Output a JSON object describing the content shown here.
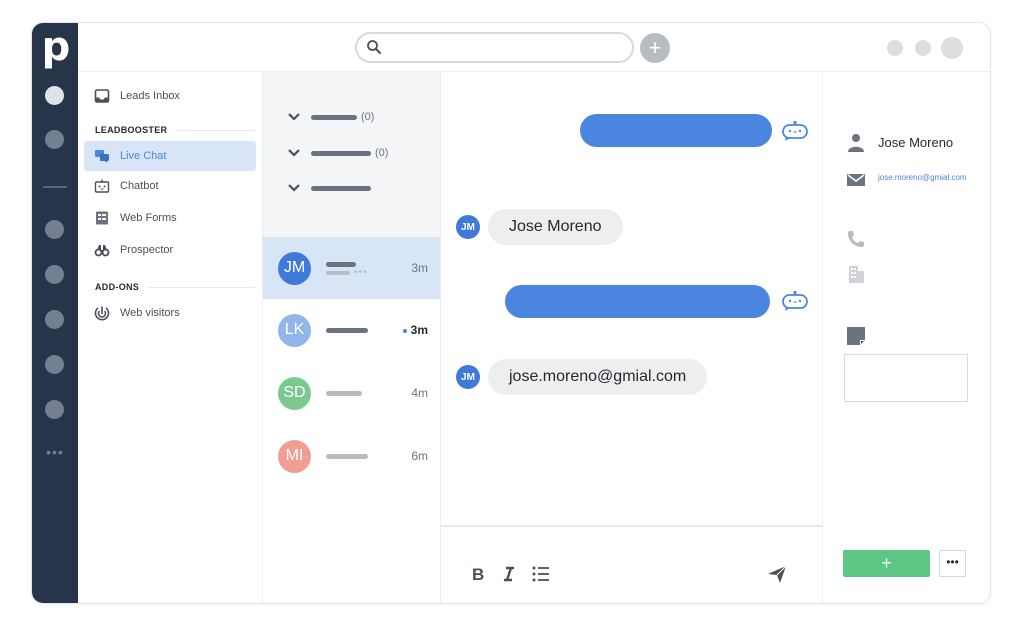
{
  "app": {
    "logo_letter": "p"
  },
  "colors": {
    "rail": "#26354a",
    "accent": "#4a85e0",
    "active_bg": "#d8e5f7",
    "success": "#5cc684"
  },
  "topbar": {
    "search": {
      "placeholder": "",
      "value": ""
    },
    "add_label": "+"
  },
  "sidebar": {
    "items": [
      {
        "label": "Leads Inbox",
        "icon": "inbox-icon"
      },
      {
        "section": "LEADBOOSTER"
      },
      {
        "label": "Live Chat",
        "icon": "chat-bubbles-icon",
        "active": true
      },
      {
        "label": "Chatbot",
        "icon": "chatbot-icon"
      },
      {
        "label": "Web Forms",
        "icon": "form-icon"
      },
      {
        "label": "Prospector",
        "icon": "binoculars-icon"
      },
      {
        "section": "ADD-ONS"
      },
      {
        "label": "Web visitors",
        "icon": "radar-icon"
      }
    ],
    "leads_inbox": "Leads Inbox",
    "section_leadbooster": "LEADBOOSTER",
    "live_chat": "Live Chat",
    "chatbot": "Chatbot",
    "web_forms": "Web Forms",
    "prospector": "Prospector",
    "section_addons": "ADD-ONS",
    "web_visitors": "Web visitors"
  },
  "filters": [
    {
      "count": "(0)"
    },
    {
      "count": "(0)"
    },
    {
      "count": ""
    }
  ],
  "conversations": [
    {
      "initials": "JM",
      "time": "3m",
      "color": "#3f7ad9",
      "active": true,
      "typing": true
    },
    {
      "initials": "LK",
      "time": "3m",
      "color": "#93b6ea",
      "unread": true
    },
    {
      "initials": "SD",
      "time": "4m",
      "color": "#7cc98f"
    },
    {
      "initials": "MI",
      "time": "6m",
      "color": "#f29d92"
    }
  ],
  "chat": {
    "messages": [
      {
        "from": "bot",
        "text": ""
      },
      {
        "from": "visitor",
        "initials": "JM",
        "text": "Jose Moreno"
      },
      {
        "from": "bot",
        "text": ""
      },
      {
        "from": "visitor",
        "initials": "JM",
        "text": "jose.moreno@gmial.com"
      }
    ],
    "composer": {
      "bold": "B",
      "italic": "I",
      "tools": [
        "bold-icon",
        "italic-icon",
        "list-icon",
        "send-icon"
      ]
    }
  },
  "contact": {
    "name": "Jose Moreno",
    "email": "jose.moreno@gmial.com",
    "phone": "",
    "organization": "",
    "note": "",
    "add_label": "+",
    "more_label": "•••"
  }
}
